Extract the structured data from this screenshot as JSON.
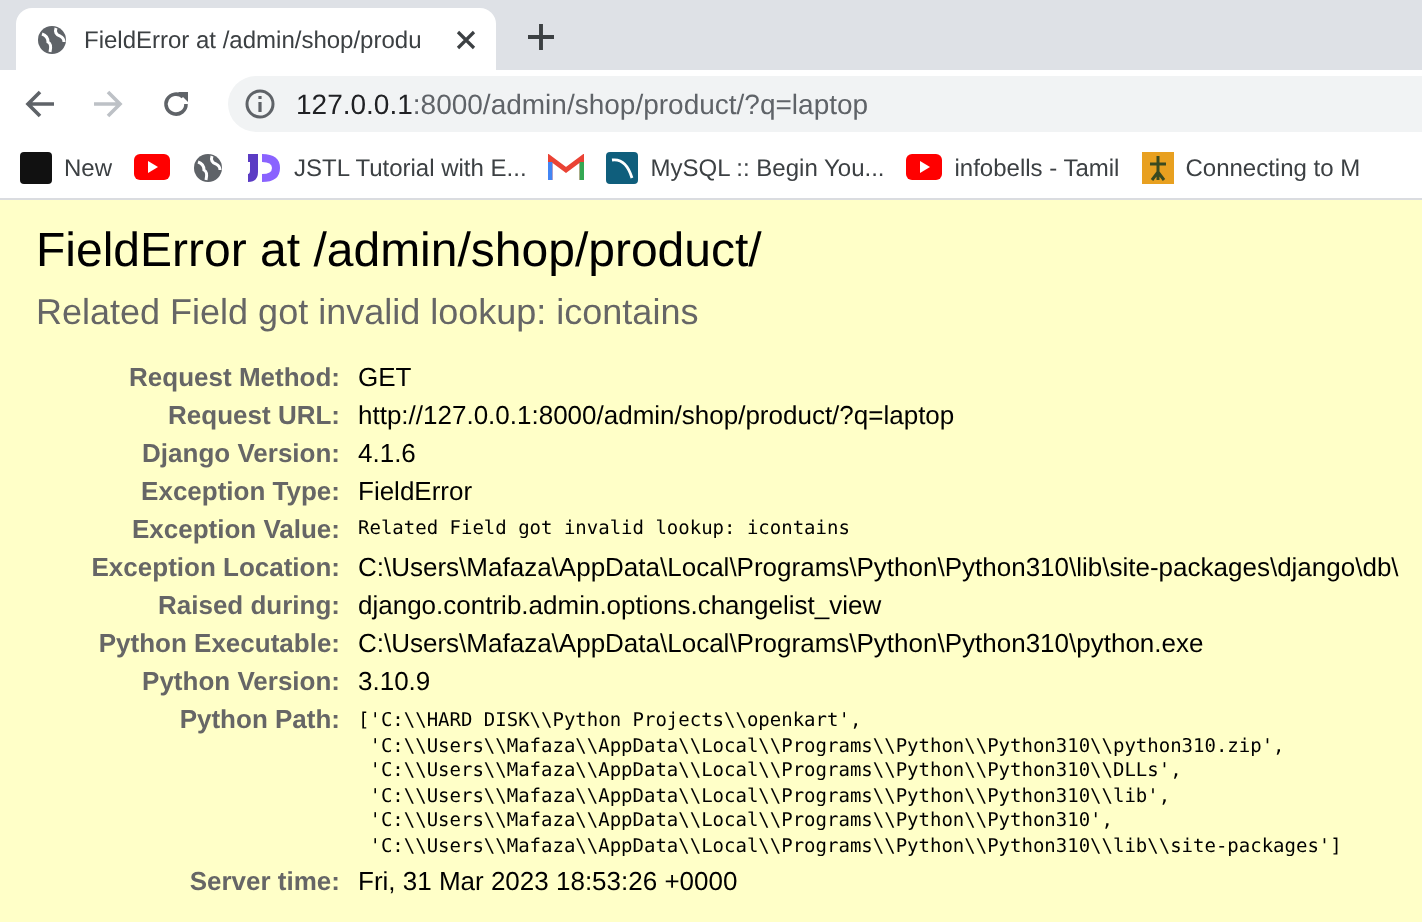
{
  "tab": {
    "title": "FieldError at /admin/shop/produ",
    "selected": true
  },
  "address_bar": {
    "host": "127.0.0.1",
    "rest": ":8000/admin/shop/product/?q=laptop"
  },
  "bookmarks": [
    {
      "kind": "st",
      "label": "New"
    },
    {
      "kind": "youtube"
    },
    {
      "kind": "globe"
    },
    {
      "kind": "jd",
      "label": "JSTL Tutorial with E..."
    },
    {
      "kind": "gmail"
    },
    {
      "kind": "mysql",
      "label": "MySQL :: Begin You..."
    },
    {
      "kind": "youtube",
      "label": "infobells - Tamil"
    },
    {
      "kind": "image",
      "label": "Connecting to M"
    }
  ],
  "error": {
    "title": "FieldError at /admin/shop/product/",
    "subtitle": "Related Field got invalid lookup: icontains"
  },
  "details": [
    {
      "label": "Request Method:",
      "kind": "text",
      "value": "GET"
    },
    {
      "label": "Request URL:",
      "kind": "text",
      "value": "http://127.0.0.1:8000/admin/shop/product/?q=laptop"
    },
    {
      "label": "Django Version:",
      "kind": "text",
      "value": "4.1.6"
    },
    {
      "label": "Exception Type:",
      "kind": "text",
      "value": "FieldError"
    },
    {
      "label": "Exception Value:",
      "kind": "code",
      "value": "Related Field got invalid lookup: icontains"
    },
    {
      "label": "Exception Location:",
      "kind": "text",
      "value": "C:\\Users\\Mafaza\\AppData\\Local\\Programs\\Python\\Python310\\lib\\site-packages\\django\\db\\"
    },
    {
      "label": "Raised during:",
      "kind": "text",
      "value": "django.contrib.admin.options.changelist_view"
    },
    {
      "label": "Python Executable:",
      "kind": "text",
      "value": "C:\\Users\\Mafaza\\AppData\\Local\\Programs\\Python\\Python310\\python.exe"
    },
    {
      "label": "Python Version:",
      "kind": "text",
      "value": "3.10.9"
    },
    {
      "label": "Python Path:",
      "kind": "lines",
      "lines": [
        "['C:\\\\HARD DISK\\\\Python Projects\\\\openkart',",
        " 'C:\\\\Users\\\\Mafaza\\\\AppData\\\\Local\\\\Programs\\\\Python\\\\Python310\\\\python310.zip',",
        " 'C:\\\\Users\\\\Mafaza\\\\AppData\\\\Local\\\\Programs\\\\Python\\\\Python310\\\\DLLs',",
        " 'C:\\\\Users\\\\Mafaza\\\\AppData\\\\Local\\\\Programs\\\\Python\\\\Python310\\\\lib',",
        " 'C:\\\\Users\\\\Mafaza\\\\AppData\\\\Local\\\\Programs\\\\Python\\\\Python310',",
        " 'C:\\\\Users\\\\Mafaza\\\\AppData\\\\Local\\\\Programs\\\\Python\\\\Python310\\\\lib\\\\site-packages']"
      ]
    },
    {
      "label": "Server time:",
      "kind": "text",
      "value": "Fri, 31 Mar 2023 18:53:26 +0000"
    }
  ]
}
